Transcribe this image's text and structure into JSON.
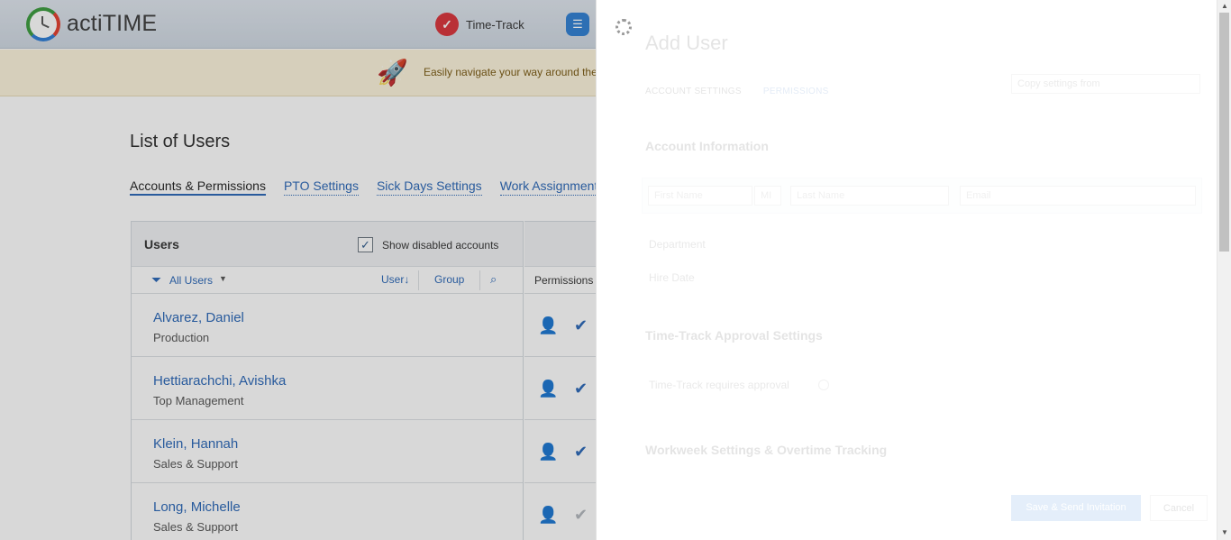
{
  "header": {
    "brand": "actiTIME",
    "nav_timetrack": "Time-Track"
  },
  "banner": {
    "text": "Easily navigate your way around the"
  },
  "page": {
    "title": "List of Users",
    "tabs": [
      "Accounts & Permissions",
      "PTO Settings",
      "Sick Days Settings",
      "Work Assignment"
    ]
  },
  "users_panel": {
    "title": "Users",
    "show_disabled_label": "Show disabled accounts",
    "show_disabled_checked": true,
    "filter_label": "All Users",
    "sort_user": "User",
    "sort_group": "Group",
    "rows": [
      {
        "name": "Alvarez, Daniel",
        "department": "Production"
      },
      {
        "name": "Hettiarachchi, Avishka",
        "department": "Top Management"
      },
      {
        "name": "Klein, Hannah",
        "department": "Sales & Support"
      },
      {
        "name": "Long, Michelle",
        "department": "Sales & Support"
      }
    ]
  },
  "permissions_panel": {
    "header": "Permissions"
  },
  "add_user_panel": {
    "title": "Add User",
    "tabs": [
      "ACCOUNT SETTINGS",
      "PERMISSIONS"
    ],
    "copy_settings_placeholder": "Copy settings from",
    "section_account": "Account Information",
    "first_name_placeholder": "First Name",
    "middle_initial_placeholder": "MI",
    "last_name_placeholder": "Last Name",
    "email_placeholder": "Email",
    "department_label": "Department",
    "hire_date_label": "Hire Date",
    "section_approval": "Time-Track Approval Settings",
    "approval_label": "Time-Track requires approval",
    "section_workweek": "Workweek Settings & Overtime Tracking",
    "save_button": "Save & Send Invitation",
    "cancel_button": "Cancel"
  }
}
